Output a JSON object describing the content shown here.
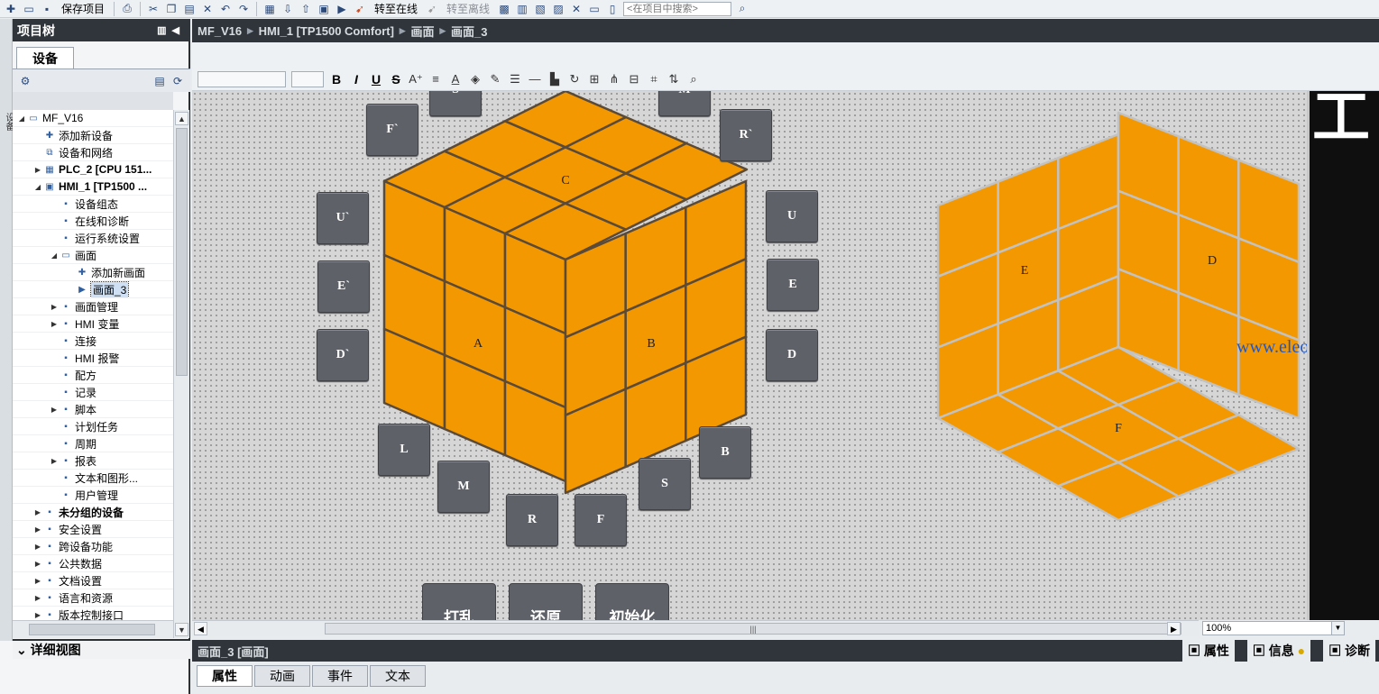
{
  "toolbar": {
    "save_label": "保存项目",
    "go_online": "转至在线",
    "go_offline": "转至离线",
    "search_placeholder": "<在项目中搜索>"
  },
  "left_panel": {
    "title": "项目树",
    "devices_tab": "设备",
    "side_label": "设备",
    "detail_view": "详细视图"
  },
  "tree": [
    {
      "label": "MF_V16",
      "indent": 0,
      "arrow": "▼",
      "icon": "project-icon",
      "bold": false
    },
    {
      "label": "添加新设备",
      "indent": 1,
      "arrow": "",
      "icon": "add-device-icon",
      "bold": false
    },
    {
      "label": "设备和网络",
      "indent": 1,
      "arrow": "",
      "icon": "network-icon",
      "bold": false
    },
    {
      "label": "PLC_2 [CPU 151...",
      "indent": 1,
      "arrow": "▶",
      "icon": "plc-icon",
      "bold": true
    },
    {
      "label": "HMI_1 [TP1500 ...",
      "indent": 1,
      "arrow": "▼",
      "icon": "hmi-icon",
      "bold": true
    },
    {
      "label": "设备组态",
      "indent": 2,
      "arrow": "",
      "icon": "device-config-icon",
      "bold": false
    },
    {
      "label": "在线和诊断",
      "indent": 2,
      "arrow": "",
      "icon": "online-diagnostic-icon",
      "bold": false
    },
    {
      "label": "运行系统设置",
      "indent": 2,
      "arrow": "",
      "icon": "runtime-settings-icon",
      "bold": false
    },
    {
      "label": "画面",
      "indent": 2,
      "arrow": "▼",
      "icon": "folder-icon",
      "bold": false
    },
    {
      "label": "添加新画面",
      "indent": 3,
      "arrow": "",
      "icon": "add-screen-icon",
      "bold": false
    },
    {
      "label": "画面_3",
      "indent": 3,
      "arrow": "",
      "icon": "screen-icon",
      "bold": false,
      "selected": true
    },
    {
      "label": "画面管理",
      "indent": 2,
      "arrow": "▶",
      "icon": "screen-management-icon",
      "bold": false
    },
    {
      "label": "HMI 变量",
      "indent": 2,
      "arrow": "▶",
      "icon": "hmi-tags-icon",
      "bold": false
    },
    {
      "label": "连接",
      "indent": 2,
      "arrow": "",
      "icon": "connections-icon",
      "bold": false
    },
    {
      "label": "HMI 报警",
      "indent": 2,
      "arrow": "",
      "icon": "alarm-icon",
      "bold": false
    },
    {
      "label": "配方",
      "indent": 2,
      "arrow": "",
      "icon": "recipe-icon",
      "bold": false
    },
    {
      "label": "记录",
      "indent": 2,
      "arrow": "",
      "icon": "log-icon",
      "bold": false
    },
    {
      "label": "脚本",
      "indent": 2,
      "arrow": "▶",
      "icon": "script-icon",
      "bold": false
    },
    {
      "label": "计划任务",
      "indent": 2,
      "arrow": "",
      "icon": "scheduler-icon",
      "bold": false
    },
    {
      "label": "周期",
      "indent": 2,
      "arrow": "",
      "icon": "cycle-icon",
      "bold": false
    },
    {
      "label": "报表",
      "indent": 2,
      "arrow": "▶",
      "icon": "report-icon",
      "bold": false
    },
    {
      "label": "文本和图形...",
      "indent": 2,
      "arrow": "",
      "icon": "text-graphics-icon",
      "bold": false
    },
    {
      "label": "用户管理",
      "indent": 2,
      "arrow": "",
      "icon": "user-management-icon",
      "bold": false
    },
    {
      "label": "未分组的设备",
      "indent": 1,
      "arrow": "▶",
      "icon": "ungrouped-devices-icon",
      "bold": true
    },
    {
      "label": "安全设置",
      "indent": 1,
      "arrow": "▶",
      "icon": "security-icon",
      "bold": false
    },
    {
      "label": "跨设备功能",
      "indent": 1,
      "arrow": "▶",
      "icon": "cross-device-icon",
      "bold": false
    },
    {
      "label": "公共数据",
      "indent": 1,
      "arrow": "▶",
      "icon": "common-data-icon",
      "bold": false
    },
    {
      "label": "文档设置",
      "indent": 1,
      "arrow": "▶",
      "icon": "document-settings-icon",
      "bold": false
    },
    {
      "label": "语言和资源",
      "indent": 1,
      "arrow": "▶",
      "icon": "language-icon",
      "bold": false
    },
    {
      "label": "版本控制接口",
      "indent": 1,
      "arrow": "▶",
      "icon": "version-control-icon",
      "bold": false
    }
  ],
  "breadcrumb": [
    "MF_V16",
    "HMI_1 [TP1500 Comfort]",
    "画面",
    "画面_3"
  ],
  "cube_front": {
    "top": "C",
    "left": "A",
    "right": "B"
  },
  "cube_back": {
    "left": "E",
    "right": "D",
    "bottom": "F"
  },
  "buttons": {
    "s_top": "S",
    "m_top": "M",
    "f_prime": "F`",
    "r_prime": "R`",
    "u_prime": "U`",
    "u": "U",
    "e_prime": "E`",
    "e": "E",
    "d_prime": "D`",
    "d": "D",
    "l": "L",
    "b": "B",
    "m": "M",
    "s": "S",
    "r": "R",
    "f": "F",
    "scramble": "打乱",
    "restore": "还原",
    "init": "初始化"
  },
  "watermark": "www.eleok.com",
  "right_panel_glyph": "工",
  "zoom": "100%",
  "properties": {
    "title": "画面_3 [画面]",
    "tabs": [
      "属性",
      "动画",
      "事件",
      "文本"
    ],
    "right_tabs": [
      "属性",
      "信息",
      "诊断"
    ]
  },
  "colors": {
    "cube_face": "#f39800",
    "cube_edge": "#5a4a37",
    "button": "#5f6168",
    "title_bar": "#2f353b"
  }
}
